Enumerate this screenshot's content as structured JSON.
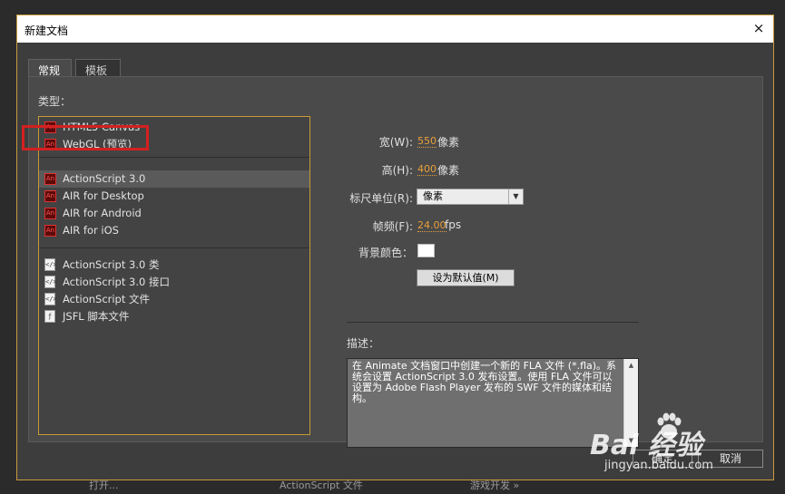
{
  "background": {
    "items": [
      "打开...",
      "ActionScript 文件",
      "游戏开发 »"
    ]
  },
  "dialog": {
    "title": "新建文档",
    "close_icon": "×",
    "tabs": [
      {
        "label": "常规",
        "active": true
      },
      {
        "label": "模板",
        "active": false
      }
    ],
    "type_label": "类型：",
    "types": [
      {
        "label": "HTML5 Canvas",
        "icon": "an-icon"
      },
      {
        "label": "WebGL (预览)",
        "icon": "an-icon"
      },
      {
        "label": "ActionScript 3.0",
        "icon": "an-icon",
        "selected": true
      },
      {
        "label": "AIR for Desktop",
        "icon": "an-icon"
      },
      {
        "label": "AIR for Android",
        "icon": "an-icon"
      },
      {
        "label": "AIR for iOS",
        "icon": "an-icon"
      },
      {
        "label": "ActionScript 3.0 类",
        "icon": "code-doc-icon"
      },
      {
        "label": "ActionScript 3.0 接口",
        "icon": "code-doc-icon"
      },
      {
        "label": "ActionScript 文件",
        "icon": "code-doc-icon"
      },
      {
        "label": "JSFL 脚本文件",
        "icon": "script-doc-icon"
      }
    ],
    "props": {
      "width_label": "宽(W):",
      "width_value": "550",
      "width_unit": "像素",
      "height_label": "高(H):",
      "height_value": "400",
      "height_unit": "像素",
      "ruler_label": "标尺单位(R):",
      "ruler_value": "像素",
      "fps_label": "帧频(F):",
      "fps_value": "24.00",
      "fps_unit": "fps",
      "bg_label": "背景颜色：",
      "bg_color": "#ffffff",
      "default_button": "设为默认值(M)"
    },
    "description_label": "描述：",
    "description": "在 Animate 文档窗口中创建一个新的 FLA 文件 (*.fla)。系统会设置 ActionScript 3.0 发布设置。使用 FLA 文件可以设置为 Adobe Flash Player 发布的 SWF 文件的媒体和结构。",
    "ok_button": "确定",
    "cancel_button": "取消"
  },
  "watermark": {
    "logo": "Bai 经验",
    "url": "jingyan.baidu.com"
  },
  "colors": {
    "accent": "#c79a3a",
    "highlight": "#d42020",
    "value": "#e8a03a"
  }
}
